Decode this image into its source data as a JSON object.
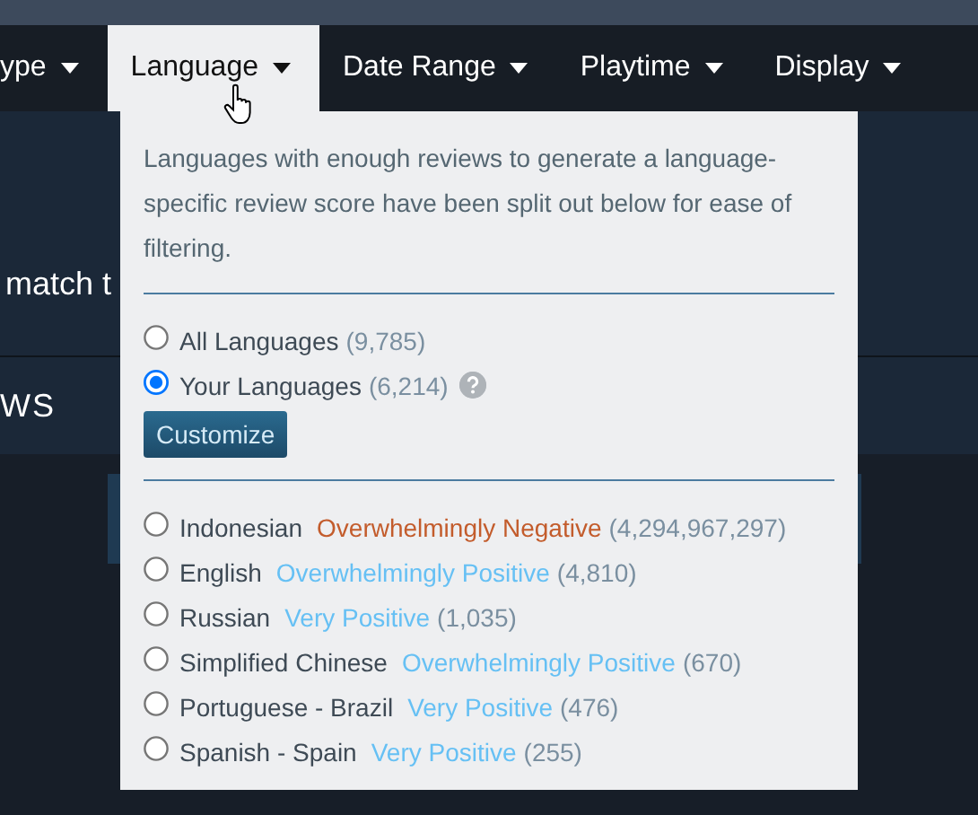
{
  "nav": {
    "tabs": [
      {
        "label": "ype",
        "selected": false
      },
      {
        "label": "Language",
        "selected": true
      },
      {
        "label": "Date Range",
        "selected": false
      },
      {
        "label": "Playtime",
        "selected": false
      },
      {
        "label": "Display",
        "selected": false
      }
    ]
  },
  "background": {
    "filter_text": "match t",
    "section_heading": "WS"
  },
  "dropdown": {
    "description": "Languages with enough reviews to generate a language-specific review score have been split out below for ease of filtering.",
    "scope_options": [
      {
        "label": "All Languages",
        "count": "(9,785)",
        "selected": false,
        "help": false
      },
      {
        "label": "Your Languages",
        "count": "(6,214)",
        "selected": true,
        "help": true
      }
    ],
    "customize_button": "Customize",
    "languages": [
      {
        "label": "Indonesian",
        "rating": "Overwhelmingly Negative",
        "color": "#c35c2c",
        "count": "(4,294,967,297)",
        "selected": false
      },
      {
        "label": "English",
        "rating": "Overwhelmingly Positive",
        "color": "#66c0f4",
        "count": "(4,810)",
        "selected": false
      },
      {
        "label": "Russian",
        "rating": "Very Positive",
        "color": "#66c0f4",
        "count": "(1,035)",
        "selected": false
      },
      {
        "label": "Simplified Chinese",
        "rating": "Overwhelmingly Positive",
        "color": "#66c0f4",
        "count": "(670)",
        "selected": false
      },
      {
        "label": "Portuguese - Brazil",
        "rating": "Very Positive",
        "color": "#66c0f4",
        "count": "(476)",
        "selected": false
      },
      {
        "label": "Spanish - Spain",
        "rating": "Very Positive",
        "color": "#66c0f4",
        "count": "(255)",
        "selected": false
      }
    ]
  }
}
